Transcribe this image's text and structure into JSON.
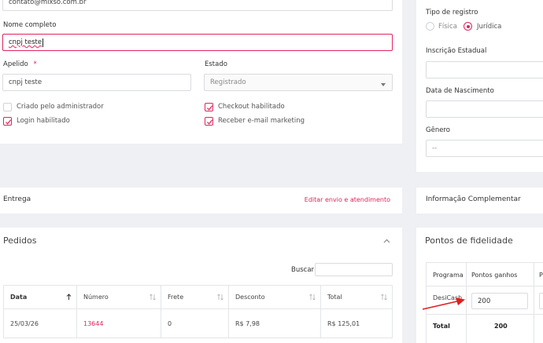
{
  "colors": {
    "accent": "#e0245e",
    "background": "#eef0f3",
    "card": "#ffffff",
    "border": "#d9dce1"
  },
  "customer": {
    "email_value": "contato@mixso.com.br",
    "full_name_label": "Nome completo",
    "full_name_value": "cnpj teste",
    "nickname_label": "Apelido",
    "required_mark": "*",
    "nickname_value": "cnpj teste",
    "state_label": "Estado",
    "state_value": "Registrado",
    "checkboxes": {
      "created_by_admin": {
        "label": "Criado pelo administrador",
        "checked": false
      },
      "checkout_enabled": {
        "label": "Checkout habilitado",
        "checked": true
      },
      "login_enabled": {
        "label": "Login habilitado",
        "checked": true
      },
      "email_marketing": {
        "label": "Receber e-mail marketing",
        "checked": true
      }
    }
  },
  "right_panel": {
    "registration_type_label": "Tipo de registro",
    "option_fisica": "Física",
    "option_juridica": "Jurídica",
    "selected": "Jurídica",
    "state_registration_label": "Inscrição Estadual",
    "birth_date_label": "Data de Nascimento",
    "gender_label": "Gênero",
    "gender_value": "--"
  },
  "delivery": {
    "title": "Entrega",
    "edit_link": "Editar envio e atendimento"
  },
  "extra_info": {
    "title": "Informação Complementar"
  },
  "orders": {
    "title": "Pedidos",
    "search_label": "Buscar",
    "search_value": "",
    "columns": [
      "Data",
      "Número",
      "Frete",
      "Desconto",
      "Total"
    ],
    "rows": [
      {
        "date": "25/03/26",
        "number": "13644",
        "shipping": "0",
        "discount": "R$ 7,98",
        "total": "R$ 125,01"
      }
    ]
  },
  "loyalty": {
    "title": "Pontos de fidelidade",
    "col_program": "Programa",
    "col_points": "Pontos ganhos",
    "col_third_partial": "P",
    "program_name": "DesiCash",
    "points_value": "200",
    "total_label": "Total",
    "total_value": "200"
  }
}
